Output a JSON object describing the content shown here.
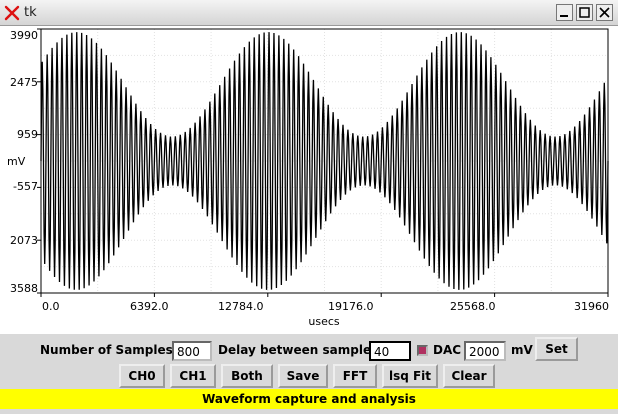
{
  "window": {
    "title": "tk"
  },
  "plot": {
    "y_ticks": [
      "3990",
      "2475",
      "959",
      "-557",
      "2073",
      "3588"
    ],
    "y_unit": "mV",
    "x_ticks": [
      "0.0",
      "6392.0",
      "12784.0",
      "19176.0",
      "25568.0",
      "31960"
    ],
    "x_unit": "usecs"
  },
  "chart_data": {
    "type": "line",
    "title": "",
    "xlabel": "usecs",
    "ylabel": "mV",
    "x_range": [
      0,
      31960
    ],
    "y_range": [
      -3588,
      3990
    ],
    "y_tick_labels": [
      "3990",
      "2475",
      "959",
      "-557",
      "2073",
      "3588"
    ],
    "x_tick_labels": [
      "0.0",
      "6392.0",
      "12784.0",
      "19176.0",
      "25568.0",
      "31960"
    ],
    "grid": true,
    "legend": "none",
    "series": [
      {
        "kind": "amplitude-modulated sinusoid",
        "carrier_cycles": 115,
        "envelope_max_mV": 3700,
        "envelope_min_mV": 700,
        "envelope_peaks_usecs": [
          2000,
          13000,
          23700
        ],
        "envelope_period_usecs": 10800,
        "color": "#000000"
      }
    ]
  },
  "controls": {
    "samples_label": "Number of Samples =",
    "samples_value": "800",
    "delay_label": "Delay between samples=",
    "delay_value": "40",
    "dac_label": "DAC",
    "dac_value": "2000",
    "dac_unit": "mV",
    "set_label": "Set"
  },
  "buttons": {
    "ch0": "CH0",
    "ch1": "CH1",
    "both": "Both",
    "save": "Save",
    "fft": "FFT",
    "lsq": "lsq Fit",
    "clear": "Clear"
  },
  "status": "Waveform capture and analysis",
  "colors": {
    "status_bg": "#ffff00",
    "checkbox": "#b03060"
  }
}
